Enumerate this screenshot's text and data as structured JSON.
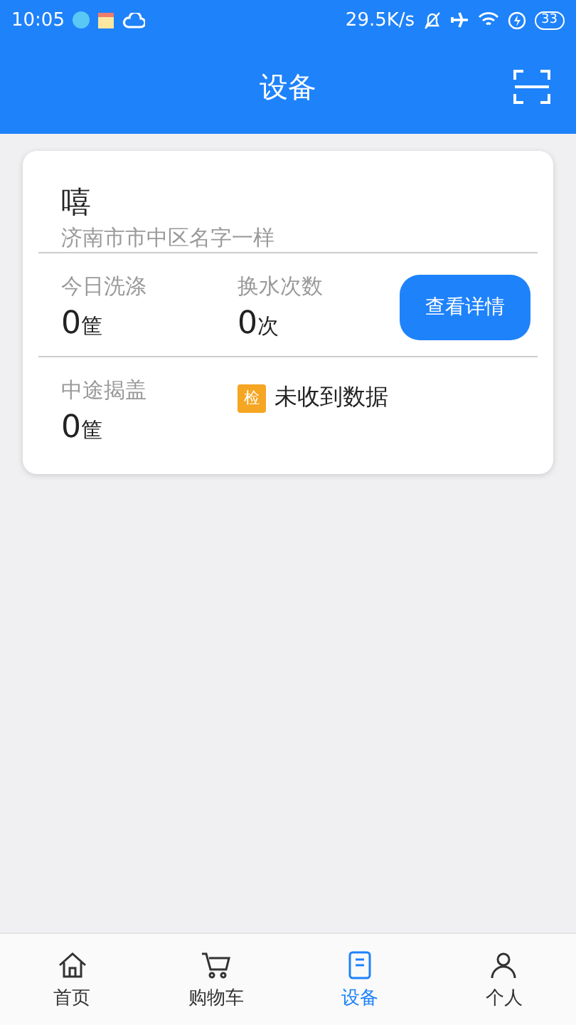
{
  "status_bar": {
    "time": "10:05",
    "network_speed": "29.5K/s",
    "battery": "33"
  },
  "header": {
    "title": "设备"
  },
  "device": {
    "name": "嘻",
    "address": "济南市市中区名字一样",
    "stats": [
      {
        "label": "今日洗涤",
        "value": "0",
        "unit": "筐"
      },
      {
        "label": "换水次数",
        "value": "0",
        "unit": "次"
      }
    ],
    "detail_button": "查看详情",
    "lid_stat": {
      "label": "中途揭盖",
      "value": "0",
      "unit": "筐"
    },
    "check": {
      "badge": "检",
      "message": "未收到数据"
    }
  },
  "tab_bar": [
    {
      "label": "首页",
      "selected": false
    },
    {
      "label": "购物车",
      "selected": false
    },
    {
      "label": "设备",
      "selected": true
    },
    {
      "label": "个人",
      "selected": false
    }
  ]
}
